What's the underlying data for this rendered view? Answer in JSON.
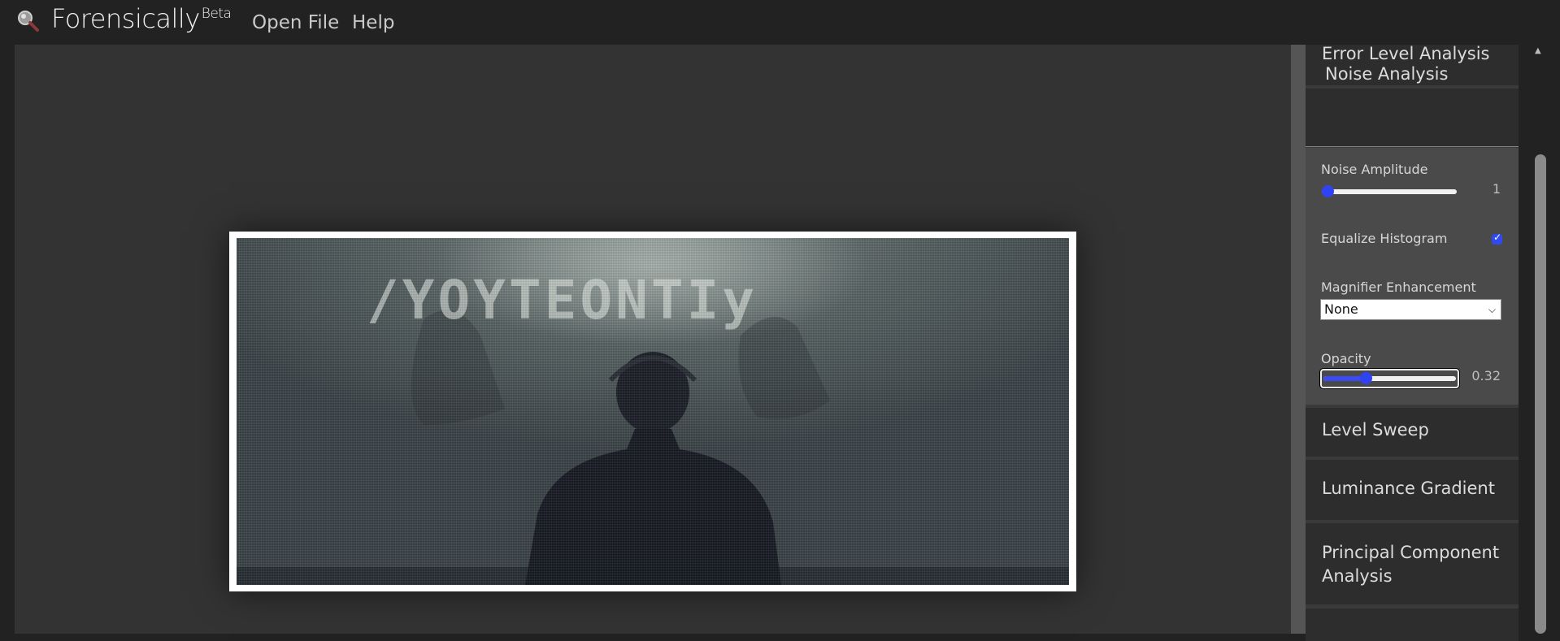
{
  "app": {
    "name": "Forensically",
    "badge": "Beta"
  },
  "nav": {
    "open_file": "Open File",
    "help": "Help"
  },
  "image": {
    "overlay_text": "/YOYTEONTIy"
  },
  "panel": {
    "sections": {
      "error_level": "Error Level Analysis",
      "noise": "Noise Analysis",
      "level_sweep": "Level Sweep",
      "luminance": "Luminance Gradient",
      "pca_line1": "Principal Component",
      "pca_line2": "Analysis"
    },
    "noise": {
      "amplitude_label": "Noise Amplitude",
      "amplitude_value": "1",
      "amplitude_fraction": 0.0,
      "equalize_label": "Equalize Histogram",
      "equalize_checked": true,
      "magnifier_label": "Magnifier Enhancement",
      "magnifier_value": "None",
      "opacity_label": "Opacity",
      "opacity_value": "0.32",
      "opacity_fraction": 0.32
    }
  },
  "colors": {
    "accent": "#2f43f5",
    "topbar": "#222222",
    "workspace": "#333333",
    "panel_header": "#2d2d2d",
    "panel_body": "#4a4a4a"
  }
}
